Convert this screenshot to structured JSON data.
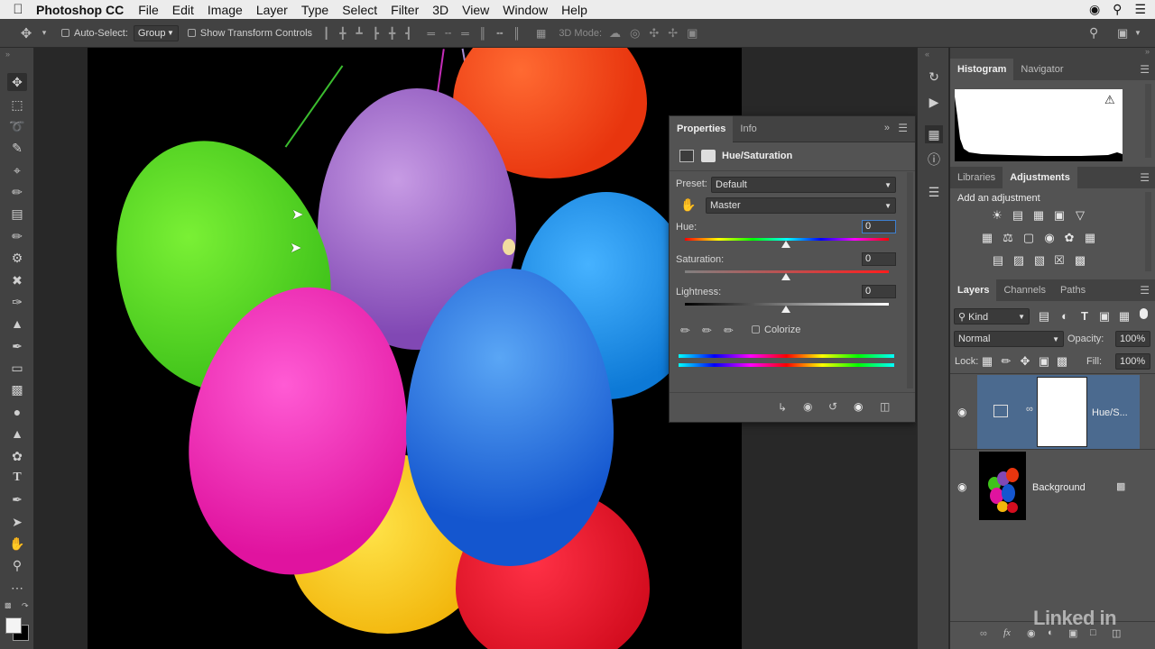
{
  "menubar": {
    "app_name": "Photoshop CC",
    "menus": [
      "File",
      "Edit",
      "Image",
      "Layer",
      "Type",
      "Select",
      "Filter",
      "3D",
      "View",
      "Window",
      "Help"
    ]
  },
  "options": {
    "auto_select_label": "Auto-Select:",
    "auto_select_value": "Group",
    "show_transform_label": "Show Transform Controls",
    "mode_3d_label": "3D Mode:"
  },
  "properties": {
    "tabs": [
      "Properties",
      "Info"
    ],
    "adjustment_name": "Hue/Saturation",
    "preset_label": "Preset:",
    "preset_value": "Default",
    "channel_value": "Master",
    "hue_label": "Hue:",
    "hue_value": "0",
    "saturation_label": "Saturation:",
    "saturation_value": "0",
    "lightness_label": "Lightness:",
    "lightness_value": "0",
    "colorize_label": "Colorize"
  },
  "histogram": {
    "tabs": [
      "Histogram",
      "Navigator"
    ]
  },
  "adjustments": {
    "tabs": [
      "Libraries",
      "Adjustments"
    ],
    "add_label": "Add an adjustment"
  },
  "layers": {
    "tabs": [
      "Layers",
      "Channels",
      "Paths"
    ],
    "filter_value": "Kind",
    "blend_mode": "Normal",
    "opacity_label": "Opacity:",
    "opacity_value": "100%",
    "lock_label": "Lock:",
    "fill_label": "Fill:",
    "fill_value": "100%",
    "items": [
      {
        "name": "Hue/S...",
        "selected": true
      },
      {
        "name": "Background",
        "selected": false
      }
    ]
  },
  "watermark": "Linked in",
  "colors": {
    "panel": "#535353",
    "panel_dark": "#424242",
    "selected_layer": "#4b6a8f"
  }
}
